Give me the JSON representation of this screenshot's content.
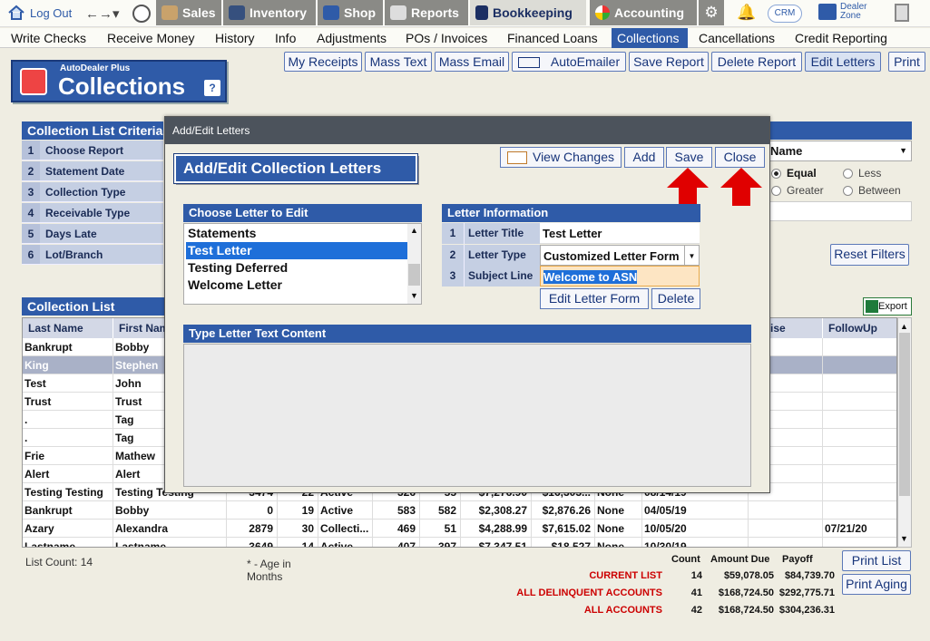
{
  "topbar": {
    "logout": "Log Out",
    "tabs": [
      "Sales",
      "Inventory",
      "Shop",
      "Reports",
      "Bookkeeping",
      "Accounting"
    ],
    "crm": "CRM",
    "dealer_zone": "Dealer Zone"
  },
  "menu": [
    "Write Checks",
    "Receive Money",
    "History",
    "Info",
    "Adjustments",
    "POs / Invoices",
    "Financed Loans",
    "Collections",
    "Cancellations",
    "Credit Reporting"
  ],
  "toolbar": [
    "My Receipts",
    "Mass Text",
    "Mass Email",
    "AutoEmailer",
    "Save Report",
    "Delete Report",
    "Edit Letters",
    "Print"
  ],
  "logo": {
    "small": "AutoDealer Plus",
    "big": "Collections",
    "help": "?"
  },
  "criteria": {
    "title": "Collection List Criteria",
    "rows": [
      {
        "n": "1",
        "label": "Choose Report"
      },
      {
        "n": "2",
        "label": "Statement Date"
      },
      {
        "n": "3",
        "label": "Collection Type"
      },
      {
        "n": "4",
        "label": "Receivable Type"
      },
      {
        "n": "5",
        "label": "Days Late"
      },
      {
        "n": "6",
        "label": "Lot/Branch"
      }
    ]
  },
  "right_filter": {
    "name_value": "Name",
    "equal": "Equal",
    "less": "Less",
    "greater": "Greater",
    "between": "Between",
    "reset": "Reset Filters"
  },
  "list": {
    "title": "Collection List",
    "export": "Export",
    "headers": [
      "Last Name",
      "First Name",
      "omise",
      "FollowUp"
    ],
    "rows": [
      [
        "Bankrupt",
        "Bobby",
        "",
        "",
        "",
        "",
        "",
        "",
        "",
        "",
        ""
      ],
      [
        "King",
        "Stephen",
        "",
        "",
        "",
        "",
        "",
        "",
        "",
        "",
        ""
      ],
      [
        "Test",
        "John",
        "",
        "",
        "",
        "",
        "",
        "",
        "",
        "",
        ""
      ],
      [
        "Trust",
        "Trust",
        "",
        "",
        "",
        "",
        "",
        "",
        "",
        "",
        ""
      ],
      [
        ".",
        "Tag",
        "",
        "",
        "",
        "",
        "",
        "",
        "",
        "",
        ""
      ],
      [
        ".",
        "Tag",
        "",
        "",
        "",
        "",
        "",
        "",
        "",
        "",
        ""
      ],
      [
        "Frie",
        "Mathew",
        "",
        "",
        "",
        "",
        "",
        "",
        "",
        "",
        ""
      ],
      [
        "Alert",
        "Alert",
        "",
        "",
        "",
        "",
        "",
        "",
        "",
        "",
        ""
      ],
      [
        "Testing Testing",
        "Testing Testing",
        "3474",
        "22",
        "Active",
        "326",
        "55",
        "$7,276.90",
        "$16,303...",
        "None",
        "08/14/19"
      ],
      [
        "Bankrupt",
        "Bobby",
        "0",
        "19",
        "Active",
        "583",
        "582",
        "$2,308.27",
        "$2,876.26",
        "None",
        "04/05/19"
      ],
      [
        "Azary",
        "Alexandra",
        "2879",
        "30",
        "Collecti...",
        "469",
        "51",
        "$4,288.99",
        "$7,615.02",
        "None",
        "10/05/20"
      ],
      [
        "Lastname",
        "Lastname",
        "3649",
        "14",
        "Active",
        "407",
        "397",
        "$7,347.51",
        "$18,527",
        "None",
        "10/30/19"
      ]
    ],
    "followups": [
      "",
      "",
      "",
      "",
      "",
      "",
      "",
      "",
      "",
      "",
      "07/21/20",
      ""
    ]
  },
  "footer": {
    "list_count": "List Count:  14",
    "age_note": "* - Age in Months",
    "count_h": "Count",
    "amount_h": "Amount Due",
    "payoff_h": "Payoff",
    "rows": [
      {
        "label": "CURRENT LIST",
        "count": "14",
        "amount": "$59,078.05",
        "payoff": "$84,739.70"
      },
      {
        "label": "ALL DELINQUENT ACCOUNTS",
        "count": "41",
        "amount": "$168,724.50",
        "payoff": "$292,775.71"
      },
      {
        "label": "ALL ACCOUNTS",
        "count": "42",
        "amount": "$168,724.50",
        "payoff": "$304,236.31"
      }
    ],
    "print_list": "Print List",
    "print_aging": "Print Aging"
  },
  "modal": {
    "title": "Add/Edit Letters",
    "heading": "Add/Edit Collection Letters",
    "view_changes": "View Changes",
    "add": "Add",
    "save": "Save",
    "close": "Close",
    "choose_title": "Choose Letter to Edit",
    "letters": [
      "Statements",
      "Test Letter",
      "Testing Deferred",
      "Welcome Letter"
    ],
    "info_title": "Letter Information",
    "info": [
      {
        "n": "1",
        "label": "Letter Title",
        "value": "Test Letter"
      },
      {
        "n": "2",
        "label": "Letter Type",
        "value": "Customized Letter Form"
      },
      {
        "n": "3",
        "label": "Subject Line",
        "value": "Welcome to ASN"
      }
    ],
    "edit_form": "Edit Letter Form",
    "delete": "Delete",
    "content_title": "Type Letter Text Content"
  },
  "colors": {
    "accent": "#2f5ba8",
    "arrow": "#e00000",
    "selected": "#1e6fd9"
  }
}
